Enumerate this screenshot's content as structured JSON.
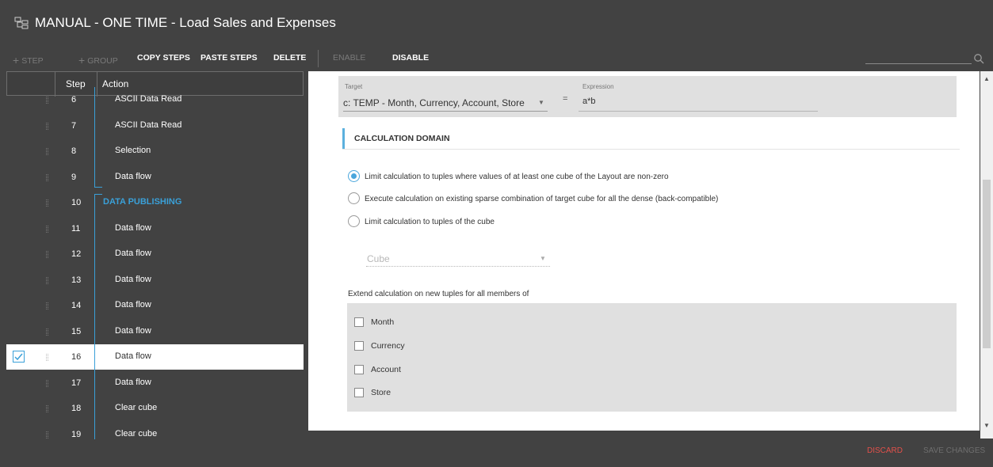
{
  "window": {
    "title": "MANUAL - ONE TIME - Load Sales and Expenses",
    "icon": "hierarchy-icon"
  },
  "toolbar": {
    "step_label": "STEP",
    "group_label": "GROUP",
    "copy_steps_label": "COPY STEPS",
    "paste_steps_label": "PASTE STEPS",
    "delete_label": "DELETE",
    "enable_label": "ENABLE",
    "disable_label": "DISABLE",
    "search_icon": "search-icon"
  },
  "steps_table": {
    "headers": {
      "step": "Step",
      "action": "Action"
    },
    "rows": [
      {
        "step": "6",
        "action": "ASCII Data Read"
      },
      {
        "step": "7",
        "action": "ASCII Data Read"
      },
      {
        "step": "8",
        "action": "Selection"
      },
      {
        "step": "9",
        "action": "Data flow"
      },
      {
        "step": "10",
        "action": "DATA PUBLISHING",
        "group": true
      },
      {
        "step": "11",
        "action": "Data flow"
      },
      {
        "step": "12",
        "action": "Data flow"
      },
      {
        "step": "13",
        "action": "Data flow"
      },
      {
        "step": "14",
        "action": "Data flow"
      },
      {
        "step": "15",
        "action": "Data flow"
      },
      {
        "step": "16",
        "action": "Data flow",
        "selected": true
      },
      {
        "step": "17",
        "action": "Data flow"
      },
      {
        "step": "18",
        "action": "Clear cube"
      },
      {
        "step": "19",
        "action": "Clear cube"
      }
    ]
  },
  "calculation": {
    "target_label": "Target",
    "target_value": "c: TEMP - Month, Currency, Account, Store",
    "equals": "=",
    "expression_label": "Expression",
    "expression_value": "a*b"
  },
  "domain": {
    "section_title": "CALCULATION DOMAIN",
    "options": [
      {
        "label": "Limit calculation to tuples where values of at least one cube of the Layout are non-zero",
        "selected": true
      },
      {
        "label": "Execute calculation on existing sparse combination of target cube for all the dense (back-compatible)",
        "selected": false
      },
      {
        "label": "Limit calculation to tuples of the cube",
        "selected": false
      }
    ],
    "cube_placeholder": "Cube",
    "extend_label": "Extend calculation on new tuples for all members of",
    "dimensions": [
      {
        "label": "Month",
        "checked": false
      },
      {
        "label": "Currency",
        "checked": false
      },
      {
        "label": "Account",
        "checked": false
      },
      {
        "label": "Store",
        "checked": false
      }
    ]
  },
  "footer": {
    "discard_label": "DISCARD",
    "save_label": "SAVE CHANGES"
  },
  "colors": {
    "accent": "#3aa0d8",
    "discard": "#e2504a",
    "background": "#424242"
  }
}
